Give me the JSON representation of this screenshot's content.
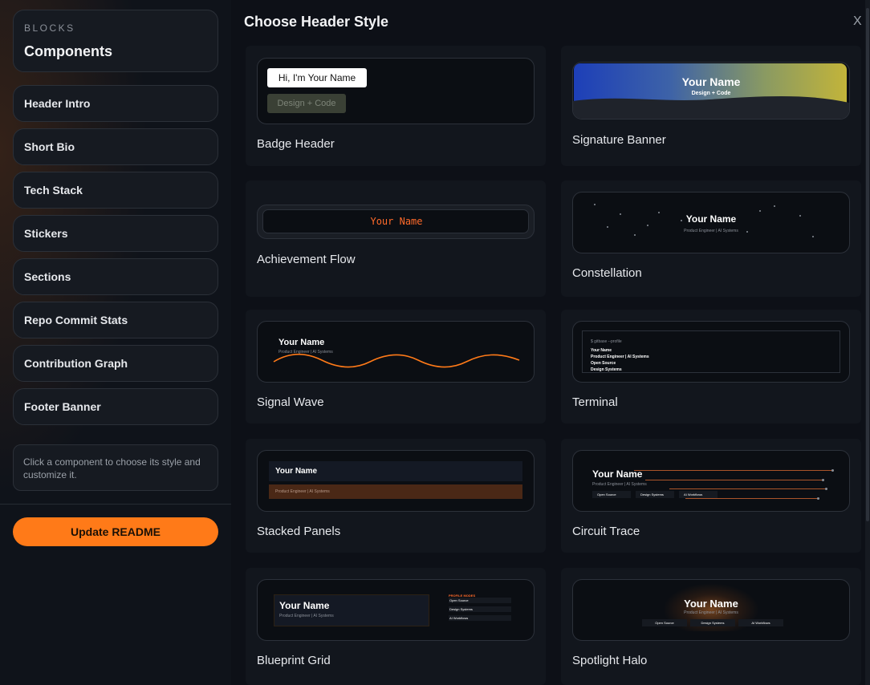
{
  "sidebar": {
    "eyebrow": "BLOCKS",
    "title": "Components",
    "items": [
      {
        "label": "Header Intro"
      },
      {
        "label": "Short Bio"
      },
      {
        "label": "Tech Stack"
      },
      {
        "label": "Stickers"
      },
      {
        "label": "Sections"
      },
      {
        "label": "Repo Commit Stats"
      },
      {
        "label": "Contribution Graph"
      },
      {
        "label": "Footer Banner"
      }
    ],
    "hint": "Click a component to choose its style and customize it.",
    "update_button": "Update README"
  },
  "panel": {
    "title": "Choose Header Style",
    "close_label": "X"
  },
  "styles": [
    {
      "label": "Badge Header",
      "preview": {
        "name": "Hi, I'm Your Name",
        "sub": "Design + Code"
      }
    },
    {
      "label": "Signature Banner",
      "preview": {
        "name": "Your Name",
        "sub": "Design + Code"
      }
    },
    {
      "label": "Achievement Flow",
      "preview": {
        "name": "Your Name"
      }
    },
    {
      "label": "Constellation",
      "preview": {
        "name": "Your Name",
        "sub": "Product Engineer | AI Systems"
      }
    },
    {
      "label": "Signal Wave",
      "preview": {
        "name": "Your Name",
        "sub": "Product Engineer | AI Systems"
      }
    },
    {
      "label": "Terminal",
      "preview": {
        "prompt": "$ gitbase --profile",
        "lines": [
          "Your Name",
          "Product Engineer | AI Systems",
          "Open Source",
          "Design Systems"
        ]
      }
    },
    {
      "label": "Stacked Panels",
      "preview": {
        "name": "Your Name",
        "sub": "Product Engineer | AI Systems"
      }
    },
    {
      "label": "Circuit Trace",
      "preview": {
        "name": "Your Name",
        "sub": "Product Engineer | AI Systems",
        "tags": [
          "Open Source",
          "Design Systems",
          "AI Workflows"
        ]
      }
    },
    {
      "label": "Blueprint Grid",
      "preview": {
        "name": "Your Name",
        "sub": "Product Engineer | AI Systems",
        "side_label": "PROFILE MODES",
        "rows": [
          "Open Source",
          "Design Systems",
          "AI Workflows"
        ]
      }
    },
    {
      "label": "Spotlight Halo",
      "preview": {
        "name": "Your Name",
        "sub": "Product Engineer | AI Systems",
        "tags": [
          "Open Source",
          "Design Systems",
          "AI Workflows"
        ]
      }
    }
  ],
  "colors": {
    "accent": "#ff7a18",
    "background": "#0d1017",
    "card": "#161a21",
    "border": "#2b3038"
  }
}
